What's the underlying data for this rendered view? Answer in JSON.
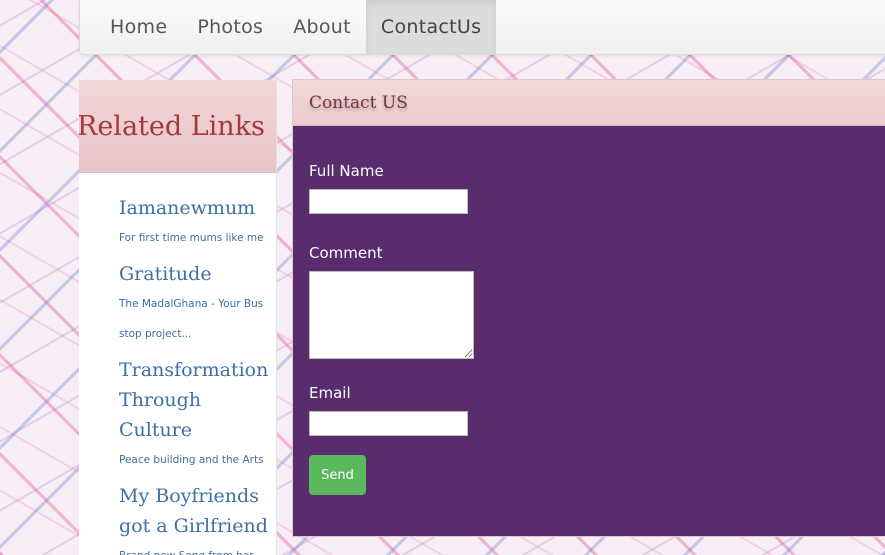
{
  "nav": {
    "items": [
      {
        "label": "Home"
      },
      {
        "label": "Photos"
      },
      {
        "label": "About"
      },
      {
        "label": "ContactUs"
      }
    ]
  },
  "sidebar": {
    "title": "Related Links",
    "links": [
      {
        "title": "Iamanewmum",
        "desc": "For first time mums like me"
      },
      {
        "title": "Gratitude",
        "desc": "The MadalGhana - Your Bus stop project..."
      },
      {
        "title": "Transformation Through Culture",
        "desc": "Peace building and the Arts"
      },
      {
        "title": "My Boyfriends got a Girlfriend",
        "desc": "Brand new Song from her"
      }
    ]
  },
  "contact": {
    "title": "Contact US",
    "full_name_label": "Full Name",
    "full_name_value": "",
    "comment_label": "Comment",
    "comment_value": "",
    "email_label": "Email",
    "email_value": "",
    "send_label": "Send"
  },
  "colors": {
    "panel_bg": "#582c6d",
    "send_button": "#5cb85c",
    "link_text": "#3f6fa3",
    "sidebar_title": "#a23a3a"
  }
}
